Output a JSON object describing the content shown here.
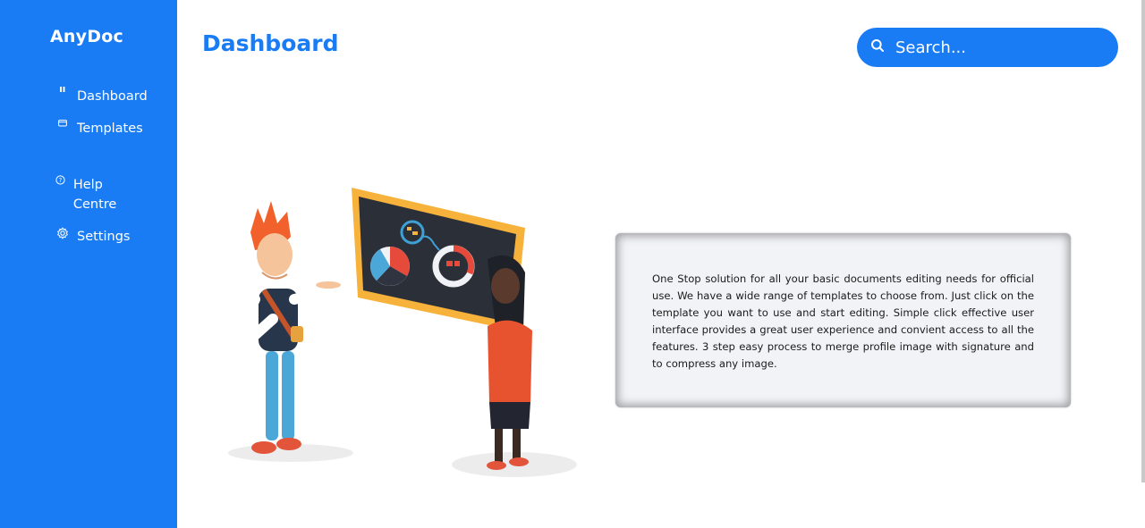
{
  "app": {
    "brand": "AnyDoc"
  },
  "sidebar": {
    "items": [
      {
        "label": "Dashboard",
        "icon": "dashboard-icon"
      },
      {
        "label": "Templates",
        "icon": "wallet-icon"
      },
      {
        "label": "Help Centre",
        "icon": "question-circle-icon"
      },
      {
        "label": "Settings",
        "icon": "gear-icon"
      }
    ]
  },
  "header": {
    "title": "Dashboard"
  },
  "search": {
    "placeholder": "Search..."
  },
  "main": {
    "description": "One Stop solution for all your basic documents editing needs for official use. We have a wide range of templates to choose from. Just click on the template you want to use and start editing. Simple click effective user interface provides a great user experience and convient access to all the features. 3 step easy process to merge profile image with signature and to compress any image."
  },
  "colors": {
    "accent": "#1a7cf5",
    "card_bg": "#f2f3f7"
  }
}
